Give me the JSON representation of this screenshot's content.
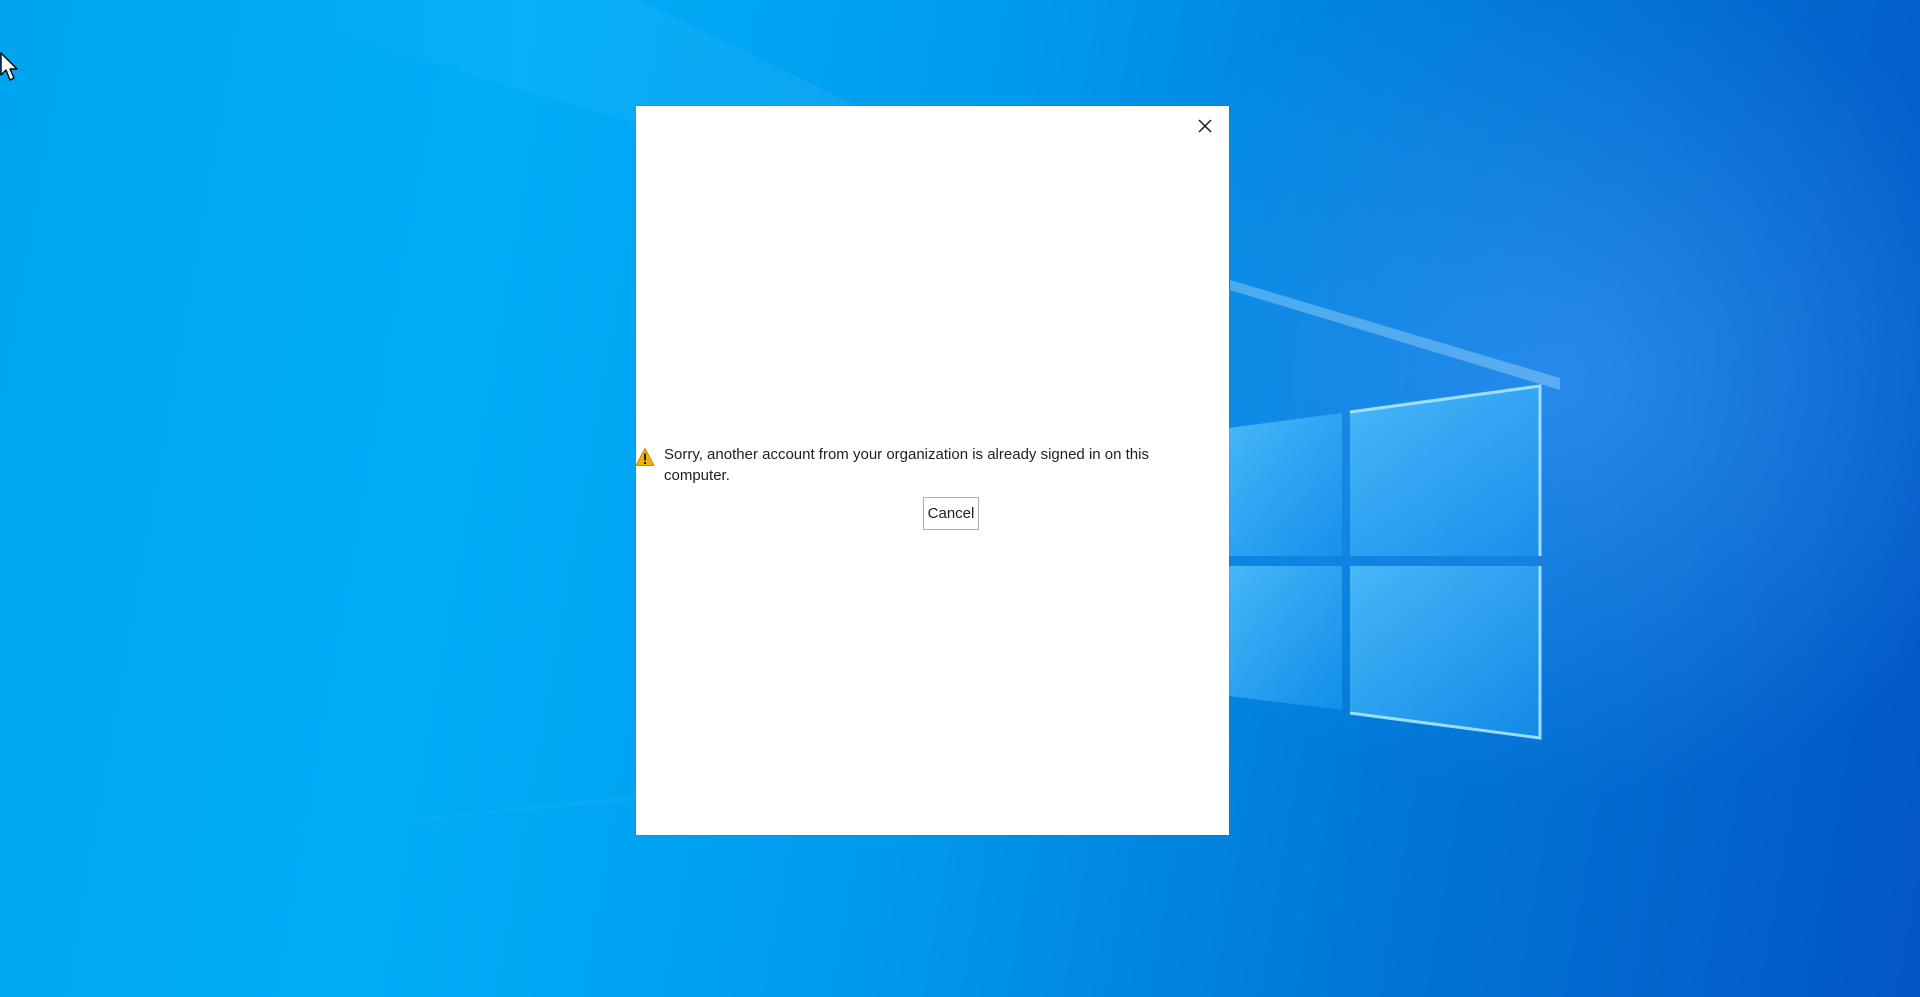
{
  "desktop": {
    "background_accent": "#0078d7",
    "logo_color": "#7fd4ff"
  },
  "cursor": {
    "icon": "arrow-cursor-icon"
  },
  "dialog": {
    "close_icon": "close-icon",
    "warning_icon": "warning-icon",
    "warning_color": "#f0b400",
    "message": "Sorry, another account from your organization is already signed in on this computer.",
    "cancel_label": "Cancel"
  }
}
